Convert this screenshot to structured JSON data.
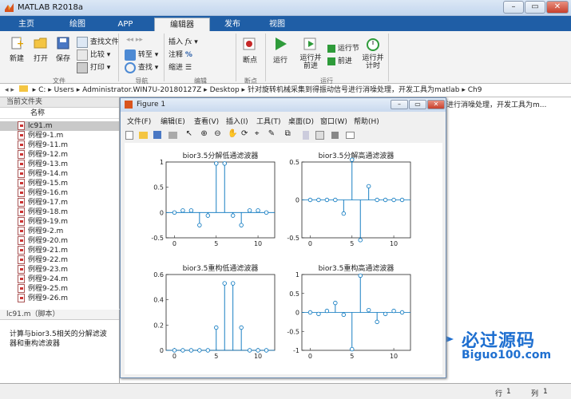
{
  "window": {
    "title": "MATLAB R2018a"
  },
  "tabs": [
    {
      "label": "主页"
    },
    {
      "label": "绘图"
    },
    {
      "label": "APP"
    },
    {
      "label": "编辑器"
    },
    {
      "label": "发布"
    },
    {
      "label": "视图"
    }
  ],
  "search": {
    "placeholder": "搜索文档"
  },
  "ribbon": {
    "file": {
      "new": "新建",
      "open": "打开",
      "save": "保存",
      "find_files": "查找文件",
      "compare": "比较",
      "print": "打印",
      "group": "文件"
    },
    "nav": {
      "goto": "转至",
      "find": "查找",
      "group": "导航"
    },
    "edit": {
      "insert": "插入",
      "comment": "注释",
      "indent": "缩进",
      "group": "编辑"
    },
    "breakpoints": {
      "label": "断点",
      "group": "断点"
    },
    "run": {
      "run": "运行",
      "run_advance": "运行并\n前进",
      "run_section": "运行节",
      "advance": "前进",
      "run_time": "运行并\n计时",
      "group": "运行"
    }
  },
  "path": {
    "segments": [
      "C:",
      "Users",
      "Administrator.WIN7U-20180127Z",
      "Desktop",
      "针对旋转机械采集到得振动信号进行消噪处理，开发工具为matlab",
      "Ch9"
    ]
  },
  "current_folder": {
    "title": "当前文件夹",
    "column": "名称",
    "files": [
      "lc91.m",
      "例程9-1.m",
      "例程9-11.m",
      "例程9-12.m",
      "例程9-13.m",
      "例程9-14.m",
      "例程9-15.m",
      "例程9-16.m",
      "例程9-17.m",
      "例程9-18.m",
      "例程9-19.m",
      "例程9-2.m",
      "例程9-20.m",
      "例程9-21.m",
      "例程9-22.m",
      "例程9-23.m",
      "例程9-24.m",
      "例程9-25.m",
      "例程9-26.m"
    ]
  },
  "details": {
    "file": "lc91.m（脚本）",
    "description": "计算与bior3.5相关的分解滤波器和重构滤波器"
  },
  "figure": {
    "title": "Figure 1",
    "menu": [
      "文件(F)",
      "编辑(E)",
      "查看(V)",
      "插入(I)",
      "工具(T)",
      "桌面(D)",
      "窗口(W)",
      "帮助(H)"
    ]
  },
  "right_text": "进行消噪处理，开发工具为m...",
  "status": {
    "row_label": "行",
    "row": "1",
    "col_label": "列",
    "col": "1"
  },
  "watermark": {
    "line1": "必过源码",
    "line2": "Biguo100.com"
  },
  "chart_data": [
    {
      "type": "stem",
      "title": "bior3.5分解低通滤波器",
      "x": [
        0,
        1,
        2,
        3,
        4,
        5,
        6,
        7,
        8,
        9,
        10,
        11
      ],
      "values": [
        0,
        0.04,
        0.04,
        -0.25,
        -0.06,
        0.97,
        0.97,
        -0.06,
        -0.25,
        0.04,
        0.04,
        0
      ],
      "xlim": [
        -1,
        12
      ],
      "ylim": [
        -0.5,
        1
      ],
      "yticks": [
        -0.5,
        0,
        0.5,
        1
      ],
      "xticks": [
        0,
        5,
        10
      ]
    },
    {
      "type": "stem",
      "title": "bior3.5分解高通滤波器",
      "x": [
        0,
        1,
        2,
        3,
        4,
        5,
        6,
        7,
        8,
        9,
        10,
        11
      ],
      "values": [
        0,
        0,
        0,
        0,
        -0.18,
        0.53,
        -0.53,
        0.18,
        0,
        0,
        0,
        0
      ],
      "xlim": [
        -1,
        12
      ],
      "ylim": [
        -0.5,
        0.5
      ],
      "yticks": [
        -0.5,
        0,
        0.5
      ],
      "xticks": [
        0,
        5,
        10
      ]
    },
    {
      "type": "stem",
      "title": "bior3.5重构低通滤波器",
      "x": [
        0,
        1,
        2,
        3,
        4,
        5,
        6,
        7,
        8,
        9,
        10,
        11
      ],
      "values": [
        0,
        0,
        0,
        0,
        0,
        0.18,
        0.53,
        0.53,
        0.18,
        0,
        0,
        0
      ],
      "xlim": [
        -1,
        12
      ],
      "ylim": [
        0,
        0.6
      ],
      "yticks": [
        0,
        0.2,
        0.4,
        0.6
      ],
      "xticks": [
        0,
        5,
        10
      ]
    },
    {
      "type": "stem",
      "title": "bior3.5重构高通滤波器",
      "x": [
        0,
        1,
        2,
        3,
        4,
        5,
        6,
        7,
        8,
        9,
        10,
        11
      ],
      "values": [
        0,
        -0.04,
        0.04,
        0.25,
        -0.06,
        -0.97,
        0.97,
        0.06,
        -0.25,
        -0.04,
        0.04,
        0
      ],
      "xlim": [
        -1,
        12
      ],
      "ylim": [
        -1,
        1
      ],
      "yticks": [
        -1,
        -0.5,
        0,
        0.5,
        1
      ],
      "xticks": [
        0,
        5,
        10
      ]
    }
  ]
}
